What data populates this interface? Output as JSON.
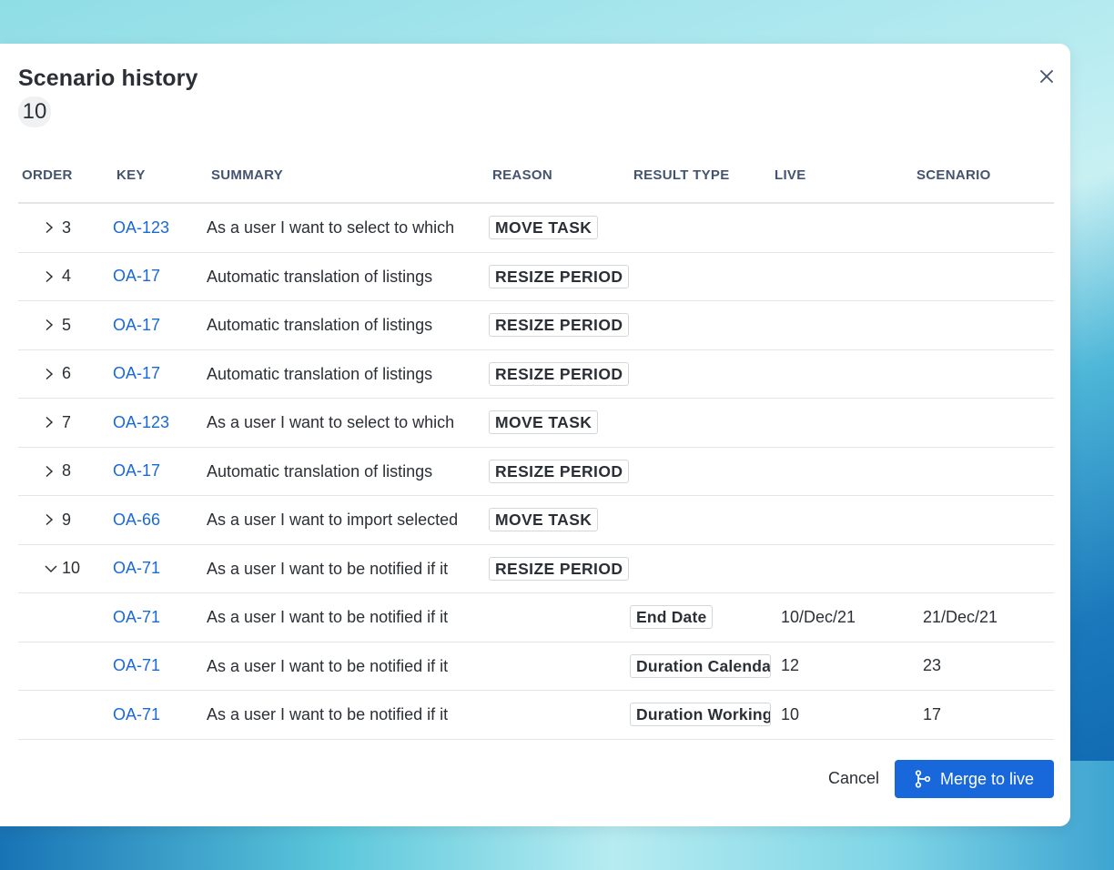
{
  "modal": {
    "title": "Scenario history",
    "count": "10"
  },
  "columns": [
    "ORDER",
    "KEY",
    "SUMMARY",
    "REASON",
    "RESULT TYPE",
    "LIVE",
    "SCENARIO"
  ],
  "rows": [
    {
      "order": "3",
      "expanded": false,
      "key": "OA-123",
      "summary": "As a user I want to select to which",
      "reason": "MOVE TASK",
      "result_type": "",
      "live": "",
      "scenario": ""
    },
    {
      "order": "4",
      "expanded": false,
      "key": "OA-17",
      "summary": "Automatic translation of listings",
      "reason": "RESIZE PERIOD",
      "result_type": "",
      "live": "",
      "scenario": ""
    },
    {
      "order": "5",
      "expanded": false,
      "key": "OA-17",
      "summary": "Automatic translation of listings",
      "reason": "RESIZE PERIOD",
      "result_type": "",
      "live": "",
      "scenario": ""
    },
    {
      "order": "6",
      "expanded": false,
      "key": "OA-17",
      "summary": "Automatic translation of listings",
      "reason": "RESIZE PERIOD",
      "result_type": "",
      "live": "",
      "scenario": ""
    },
    {
      "order": "7",
      "expanded": false,
      "key": "OA-123",
      "summary": "As a user I want to select to which",
      "reason": "MOVE TASK",
      "result_type": "",
      "live": "",
      "scenario": ""
    },
    {
      "order": "8",
      "expanded": false,
      "key": "OA-17",
      "summary": "Automatic translation of listings",
      "reason": "RESIZE PERIOD",
      "result_type": "",
      "live": "",
      "scenario": ""
    },
    {
      "order": "9",
      "expanded": false,
      "key": "OA-66",
      "summary": "As a user I want to import selected",
      "reason": "MOVE TASK",
      "result_type": "",
      "live": "",
      "scenario": ""
    },
    {
      "order": "10",
      "expanded": true,
      "key": "OA-71",
      "summary": "As a user I want to be notified if it",
      "reason": "RESIZE PERIOD",
      "result_type": "",
      "live": "",
      "scenario": ""
    },
    {
      "order": "",
      "expanded": null,
      "key": "OA-71",
      "summary": "As a user I want to be notified if it",
      "reason": "",
      "result_type": "End Date",
      "live": "10/Dec/21",
      "scenario": "21/Dec/21"
    },
    {
      "order": "",
      "expanded": null,
      "key": "OA-71",
      "summary": "As a user I want to be notified if it",
      "reason": "",
      "result_type": "Duration Calendar",
      "live": "12",
      "scenario": "23"
    },
    {
      "order": "",
      "expanded": null,
      "key": "OA-71",
      "summary": "As a user I want to be notified if it",
      "reason": "",
      "result_type": "Duration Working",
      "live": "10",
      "scenario": "17"
    }
  ],
  "footer": {
    "cancel_label": "Cancel",
    "merge_label": "Merge to live"
  },
  "colors": {
    "primary": "#1868db",
    "link": "#1868db",
    "text": "#2b2f36",
    "header_text": "#44546f",
    "divider": "#e3e5e8"
  },
  "icons": {
    "close": "close-icon",
    "collapsed": "chevron-right-icon",
    "expanded": "chevron-down-icon",
    "merge": "merge-branch-icon"
  }
}
